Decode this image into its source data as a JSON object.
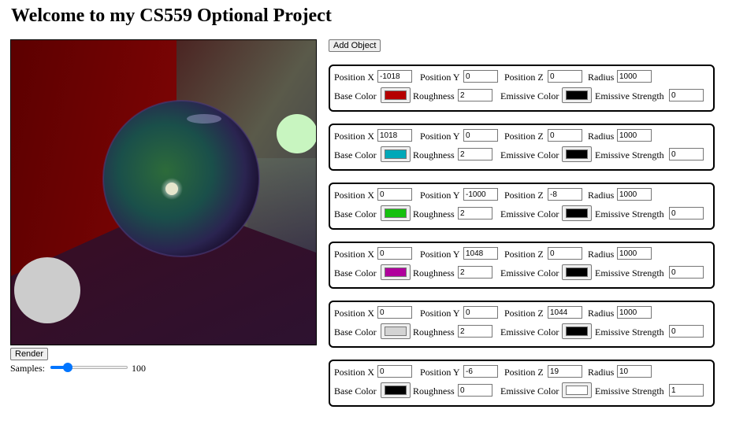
{
  "page": {
    "title": "Welcome to my CS559 Optional Project"
  },
  "controls": {
    "render_label": "Render",
    "add_label": "Add Object",
    "samples_label": "Samples:",
    "samples_value": "100",
    "samples_fraction": 0.22
  },
  "labels": {
    "pos_x": "Position X",
    "pos_y": "Position Y",
    "pos_z": "Position Z",
    "radius": "Radius",
    "base_color": "Base Color",
    "roughness": "Roughness",
    "emissive_color": "Emissive Color",
    "emissive_strength": "Emissive Strength"
  },
  "objects": [
    {
      "x": "-1018",
      "y": "0",
      "z": "0",
      "radius": "1000",
      "base_color": "#b50000",
      "roughness": "2",
      "emissive_color": "#000000",
      "emissive_strength": "0"
    },
    {
      "x": "1018",
      "y": "0",
      "z": "0",
      "radius": "1000",
      "base_color": "#00a8b8",
      "roughness": "2",
      "emissive_color": "#000000",
      "emissive_strength": "0"
    },
    {
      "x": "0",
      "y": "-1000",
      "z": "-8",
      "radius": "1000",
      "base_color": "#15c00e",
      "roughness": "2",
      "emissive_color": "#000000",
      "emissive_strength": "0"
    },
    {
      "x": "0",
      "y": "1048",
      "z": "0",
      "radius": "1000",
      "base_color": "#b0009c",
      "roughness": "2",
      "emissive_color": "#000000",
      "emissive_strength": "0"
    },
    {
      "x": "0",
      "y": "0",
      "z": "1044",
      "radius": "1000",
      "base_color": "#d3d3d3",
      "roughness": "2",
      "emissive_color": "#000000",
      "emissive_strength": "0"
    },
    {
      "x": "0",
      "y": "-6",
      "z": "19",
      "radius": "10",
      "base_color": "#000000",
      "roughness": "0",
      "emissive_color": "#ffffff",
      "emissive_strength": "1"
    }
  ]
}
